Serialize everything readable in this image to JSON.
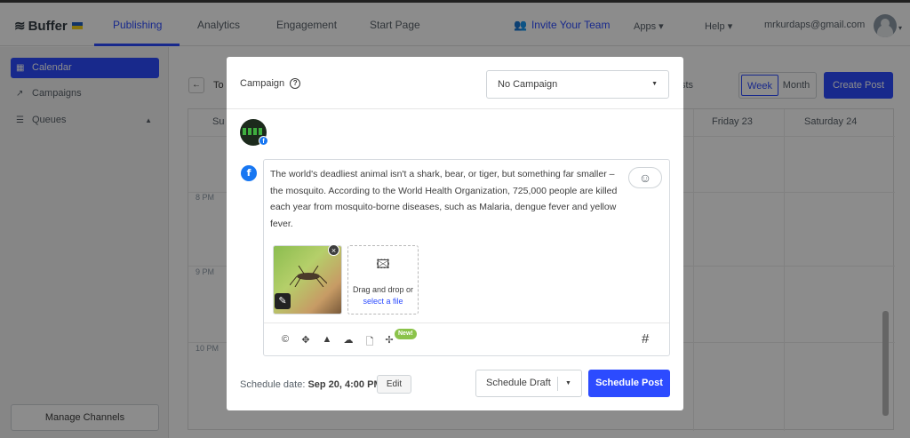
{
  "topbar": {
    "brand": "Buffer",
    "tabs": [
      "Publishing",
      "Analytics",
      "Engagement",
      "Start Page"
    ],
    "invite_label": "Invite Your Team",
    "apps_label": "Apps",
    "help_label": "Help",
    "email": "mrkurdaps@gmail.com"
  },
  "sidebar": {
    "items": [
      {
        "label": "Calendar",
        "icon": "calendar-icon",
        "active": true
      },
      {
        "label": "Campaigns",
        "icon": "chart-icon",
        "active": false
      },
      {
        "label": "Queues",
        "icon": "list-icon",
        "active": false
      }
    ],
    "manage_label": "Manage Channels"
  },
  "calendar": {
    "today_label": "To",
    "posts_label": "sts",
    "view_week": "Week",
    "view_month": "Month",
    "create_post": "Create Post",
    "day_heads": [
      "Su",
      "Friday  23",
      "Saturday  24"
    ],
    "hours": [
      "8 PM",
      "9 PM",
      "10 PM"
    ]
  },
  "modal": {
    "campaign_label": "Campaign",
    "campaign_value": "No Campaign",
    "post_text": "The world's  deadliest animal isn't a shark, bear,  or tiger, but something far smaller – the mosquito. According to the World Health Organization, 725,000 people are killed each year from mosquito-borne diseases, such as Malaria, dengue fever and yellow fever.",
    "dropzone_text": "Drag and drop or",
    "dropzone_link": "select a file",
    "new_badge": "New!",
    "schedule_prefix": "Schedule date:",
    "schedule_date": "Sep 20, 4:00 PM",
    "edit_label": "Edit",
    "draft_label": "Schedule Draft",
    "post_label": "Schedule Post",
    "toolbar_icons": [
      "canva-icon",
      "dropbox-icon",
      "google-drive-icon",
      "onedrive-icon",
      "file-icon",
      "integration-icon",
      "hashtag-icon"
    ]
  },
  "colors": {
    "accent": "#2c4bff",
    "facebook": "#1877f2",
    "new_badge": "#8bc34a"
  }
}
